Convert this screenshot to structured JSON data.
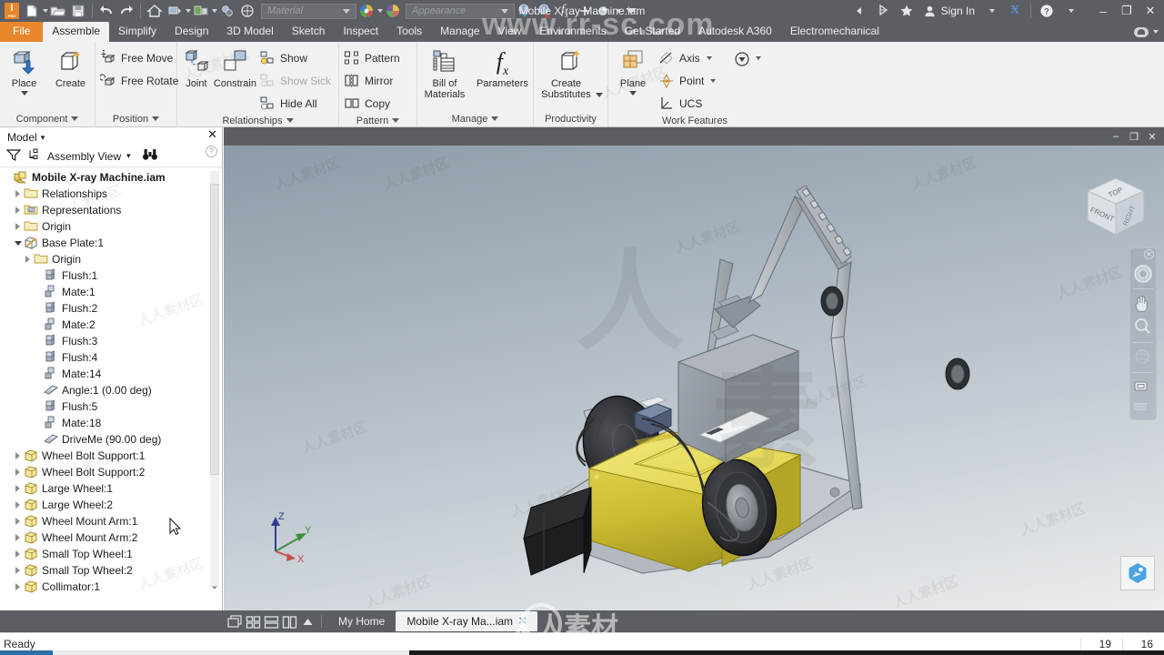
{
  "titlebar": {
    "document_title": "Mobile X-ray Machine.iam",
    "material_placeholder": "Material",
    "appearance_placeholder": "Appearance",
    "sign_in_label": "Sign In",
    "quick_access": [
      {
        "name": "inventor-logo",
        "label": "I"
      },
      {
        "name": "new-file-icon",
        "label": "New"
      },
      {
        "name": "open-file-icon",
        "label": "Open"
      },
      {
        "name": "save-icon",
        "label": "Save"
      },
      {
        "name": "undo-icon",
        "label": "Undo"
      },
      {
        "name": "redo-icon",
        "label": "Redo"
      },
      {
        "name": "home-icon",
        "label": "Home"
      },
      {
        "name": "return-icon",
        "label": "Return"
      },
      {
        "name": "update-icon",
        "label": "Update"
      },
      {
        "name": "select-icon",
        "label": "Select"
      },
      {
        "name": "appearance-globe-icon",
        "label": "Appearance"
      }
    ],
    "right_icons": [
      {
        "name": "collapse-icon",
        "label": "◄"
      },
      {
        "name": "share-icon",
        "label": "Share"
      },
      {
        "name": "favorites-star-icon",
        "label": "Favorites"
      },
      {
        "name": "user-account-icon",
        "label": "Account"
      },
      {
        "name": "exchange-app-icon",
        "label": "X"
      },
      {
        "name": "help-icon",
        "label": "?"
      }
    ],
    "window_buttons": [
      {
        "name": "minimize-button",
        "label": "–"
      },
      {
        "name": "restore-button",
        "label": "❐"
      },
      {
        "name": "close-button",
        "label": "✕"
      }
    ]
  },
  "ribbon": {
    "tabs": [
      {
        "label": "File",
        "state": "file"
      },
      {
        "label": "Assemble",
        "state": "active"
      },
      {
        "label": "Simplify",
        "state": "normal"
      },
      {
        "label": "Design",
        "state": "normal"
      },
      {
        "label": "3D Model",
        "state": "normal"
      },
      {
        "label": "Sketch",
        "state": "normal"
      },
      {
        "label": "Inspect",
        "state": "normal"
      },
      {
        "label": "Tools",
        "state": "normal"
      },
      {
        "label": "Manage",
        "state": "normal"
      },
      {
        "label": "View",
        "state": "normal"
      },
      {
        "label": "Environments",
        "state": "normal"
      },
      {
        "label": "Get Started",
        "state": "normal"
      },
      {
        "label": "Autodesk A360",
        "state": "normal"
      },
      {
        "label": "Electromechanical",
        "state": "normal"
      }
    ],
    "panels": [
      {
        "title": "Component",
        "has_title_caret": true,
        "big_buttons": [
          {
            "label": "Place",
            "icon": "place-component-icon",
            "caret": true
          },
          {
            "label": "Create",
            "icon": "create-component-icon",
            "caret": false
          }
        ],
        "small_buttons": []
      },
      {
        "title": "Position",
        "has_title_caret": true,
        "big_buttons": [],
        "small_buttons": [
          {
            "label": "Free Move",
            "icon": "free-move-icon",
            "disabled": false,
            "caret": false
          },
          {
            "label": "Free Rotate",
            "icon": "free-rotate-icon",
            "disabled": false,
            "caret": false
          }
        ]
      },
      {
        "title": "Relationships",
        "has_title_caret": true,
        "big_buttons": [
          {
            "label": "Joint",
            "icon": "joint-icon",
            "caret": false
          },
          {
            "label": "Constrain",
            "icon": "constrain-icon",
            "caret": false
          }
        ],
        "small_buttons": [
          {
            "label": "Show",
            "icon": "show-relationships-icon",
            "disabled": false,
            "caret": false
          },
          {
            "label": "Show Sick",
            "icon": "show-sick-icon",
            "disabled": true,
            "caret": false
          },
          {
            "label": "Hide All",
            "icon": "hide-all-icon",
            "disabled": false,
            "caret": false
          }
        ]
      },
      {
        "title": "Pattern",
        "has_title_caret": true,
        "big_buttons": [],
        "small_buttons": [
          {
            "label": "Pattern",
            "icon": "pattern-icon",
            "disabled": false,
            "caret": false
          },
          {
            "label": "Mirror",
            "icon": "mirror-icon",
            "disabled": false,
            "caret": false
          },
          {
            "label": "Copy",
            "icon": "copy-icon",
            "disabled": false,
            "caret": false
          }
        ]
      },
      {
        "title": "Manage",
        "has_title_caret": true,
        "big_buttons": [
          {
            "label": "Bill of Materials",
            "icon": "bill-of-materials-icon",
            "caret": false
          },
          {
            "label": "Parameters",
            "icon": "parameters-fx-icon",
            "caret": false
          }
        ],
        "small_buttons": []
      },
      {
        "title": "Productivity",
        "has_title_caret": false,
        "big_buttons": [
          {
            "label": "Create Substitutes",
            "icon": "create-substitutes-icon",
            "caret": true
          }
        ],
        "small_buttons": []
      },
      {
        "title": "Work Features",
        "has_title_caret": false,
        "big_buttons": [
          {
            "label": "Plane",
            "icon": "work-plane-icon",
            "caret": true
          }
        ],
        "small_buttons": [
          {
            "label": "Axis",
            "icon": "work-axis-icon",
            "disabled": false,
            "caret": true
          },
          {
            "label": "Point",
            "icon": "work-point-icon",
            "disabled": false,
            "caret": true
          },
          {
            "label": "UCS",
            "icon": "ucs-icon",
            "disabled": false,
            "caret": false
          }
        ],
        "extra_buttons": [
          {
            "label": "",
            "icon": "view-dropdown-icon",
            "caret": true
          }
        ]
      }
    ]
  },
  "browser": {
    "panel_title": "Model",
    "panel_title_caret": "▾",
    "filter_icon": "filter-funnel-icon",
    "view_mode": "Assembly View",
    "view_mode_caret": "▾",
    "find_icon": "binoculars-find-icon",
    "close_icon": "✕",
    "help_icon": "?",
    "scroll_up_icon": "⌃",
    "scroll_down_icon": "⌄",
    "tree": [
      {
        "label": "Mobile X-ray Machine.iam",
        "indent": 0,
        "icon": "assembly-icon",
        "expander": "none",
        "bold": true
      },
      {
        "label": "Relationships",
        "indent": 1,
        "icon": "folder-icon",
        "expander": "collapsed",
        "bold": false
      },
      {
        "label": "Representations",
        "indent": 1,
        "icon": "representations-icon",
        "expander": "collapsed",
        "bold": false
      },
      {
        "label": "Origin",
        "indent": 1,
        "icon": "folder-icon",
        "expander": "collapsed",
        "bold": false
      },
      {
        "label": "Base Plate:1",
        "indent": 1,
        "icon": "part-grounded-icon",
        "expander": "expanded",
        "bold": false
      },
      {
        "label": "Origin",
        "indent": 2,
        "icon": "folder-icon",
        "expander": "collapsed",
        "bold": false
      },
      {
        "label": "Flush:1",
        "indent": 3,
        "icon": "flush-constraint-icon",
        "expander": "none",
        "bold": false
      },
      {
        "label": "Mate:1",
        "indent": 3,
        "icon": "mate-constraint-icon",
        "expander": "none",
        "bold": false
      },
      {
        "label": "Flush:2",
        "indent": 3,
        "icon": "flush-constraint-icon",
        "expander": "none",
        "bold": false
      },
      {
        "label": "Mate:2",
        "indent": 3,
        "icon": "mate-constraint-icon",
        "expander": "none",
        "bold": false
      },
      {
        "label": "Flush:3",
        "indent": 3,
        "icon": "flush-constraint-icon",
        "expander": "none",
        "bold": false
      },
      {
        "label": "Flush:4",
        "indent": 3,
        "icon": "flush-constraint-icon",
        "expander": "none",
        "bold": false
      },
      {
        "label": "Mate:14",
        "indent": 3,
        "icon": "mate-constraint-icon",
        "expander": "none",
        "bold": false
      },
      {
        "label": "Angle:1 (0.00 deg)",
        "indent": 3,
        "icon": "angle-constraint-icon",
        "expander": "none",
        "bold": false
      },
      {
        "label": "Flush:5",
        "indent": 3,
        "icon": "flush-constraint-icon",
        "expander": "none",
        "bold": false
      },
      {
        "label": "Mate:18",
        "indent": 3,
        "icon": "mate-constraint-icon",
        "expander": "none",
        "bold": false
      },
      {
        "label": "DriveMe (90.00 deg)",
        "indent": 3,
        "icon": "angle-constraint-icon",
        "expander": "none",
        "bold": false
      },
      {
        "label": "Wheel Bolt Support:1",
        "indent": 1,
        "icon": "part-icon",
        "expander": "collapsed",
        "bold": false
      },
      {
        "label": "Wheel Bolt Support:2",
        "indent": 1,
        "icon": "part-icon",
        "expander": "collapsed",
        "bold": false
      },
      {
        "label": "Large Wheel:1",
        "indent": 1,
        "icon": "part-icon",
        "expander": "collapsed",
        "bold": false
      },
      {
        "label": "Large Wheel:2",
        "indent": 1,
        "icon": "part-icon",
        "expander": "collapsed",
        "bold": false
      },
      {
        "label": "Wheel Mount Arm:1",
        "indent": 1,
        "icon": "part-icon",
        "expander": "collapsed",
        "bold": false
      },
      {
        "label": "Wheel Mount Arm:2",
        "indent": 1,
        "icon": "part-icon",
        "expander": "collapsed",
        "bold": false
      },
      {
        "label": "Small Top Wheel:1",
        "indent": 1,
        "icon": "part-icon",
        "expander": "collapsed",
        "bold": false
      },
      {
        "label": "Small Top Wheel:2",
        "indent": 1,
        "icon": "part-icon",
        "expander": "collapsed",
        "bold": false
      },
      {
        "label": "Collimator:1",
        "indent": 1,
        "icon": "part-icon",
        "expander": "collapsed",
        "bold": false
      }
    ]
  },
  "viewport": {
    "window_buttons": [
      {
        "name": "viewport-minimize-button",
        "label": "–"
      },
      {
        "name": "viewport-restore-button",
        "label": "❐"
      },
      {
        "name": "viewport-close-button",
        "label": "✕"
      }
    ],
    "viewcube_faces": {
      "top": "TOP",
      "front": "FRONT",
      "right": "RIGHT"
    },
    "axis_labels": {
      "x": "X",
      "y": "Y",
      "z": "Z"
    },
    "axis_colors": {
      "x": "#c8504d",
      "y": "#3f8f3f",
      "z": "#2e3f8f"
    },
    "nav_tools": [
      {
        "name": "full-navigation-wheel-icon"
      },
      {
        "name": "pan-hand-icon"
      },
      {
        "name": "zoom-magnifier-icon"
      },
      {
        "name": "orbit-icon"
      },
      {
        "name": "look-at-camera-icon"
      },
      {
        "name": "nav-settings-icon"
      }
    ],
    "nav_close_icon": "✕",
    "a360_icon": "autodesk-a360-share-icon"
  },
  "doctabs": {
    "layout_icons": [
      {
        "name": "cascade-windows-icon"
      },
      {
        "name": "tile-windows-icon"
      },
      {
        "name": "tile-horizontal-icon"
      },
      {
        "name": "tile-vertical-icon"
      },
      {
        "name": "expand-tabs-icon"
      }
    ],
    "tabs": [
      {
        "label": "My Home",
        "active": false,
        "closable": false
      },
      {
        "label": "Mobile X-ray Ma...iam",
        "active": true,
        "closable": true,
        "close_label": "✕"
      }
    ]
  },
  "statusbar": {
    "message": "Ready",
    "counter_1": "19",
    "counter_2": "16"
  },
  "watermarks": {
    "url": "www.rr-sc.com",
    "site_cn": "人人素材",
    "tile_cn": "人人素材区"
  },
  "colors": {
    "chrome_dark": "#5b5f63",
    "ribbon_bg": "#f1f1f1",
    "file_orange": "#e8862c",
    "accent_blue": "#2b6ea8",
    "model_yellow": "#d4c53a",
    "model_gray": "#9aa0a6"
  }
}
